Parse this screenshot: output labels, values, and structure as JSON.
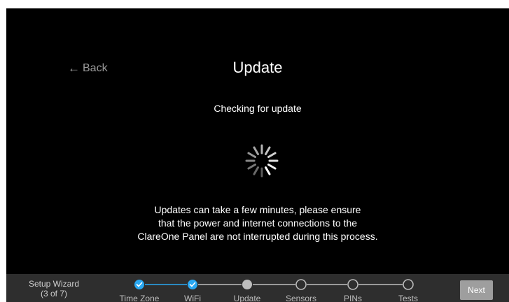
{
  "header": {
    "back_label": "Back",
    "title": "Update"
  },
  "status_text": "Checking for update",
  "message_lines": [
    "Updates can take a few minutes, please ensure",
    "that the power and internet connections to the",
    "ClareOne Panel are not interrupted during this process."
  ],
  "footer": {
    "wizard_title": "Setup Wizard",
    "wizard_progress": "(3 of 7)",
    "steps": [
      {
        "label": "Time Zone",
        "state": "done"
      },
      {
        "label": "WiFi",
        "state": "done"
      },
      {
        "label": "Update",
        "state": "current"
      },
      {
        "label": "Sensors",
        "state": "pending"
      },
      {
        "label": "PINs",
        "state": "pending"
      },
      {
        "label": "Tests",
        "state": "pending"
      }
    ],
    "next_label": "Next"
  },
  "colors": {
    "accent": "#29a8f2",
    "background": "#000000",
    "footer": "#2e2e2e"
  }
}
